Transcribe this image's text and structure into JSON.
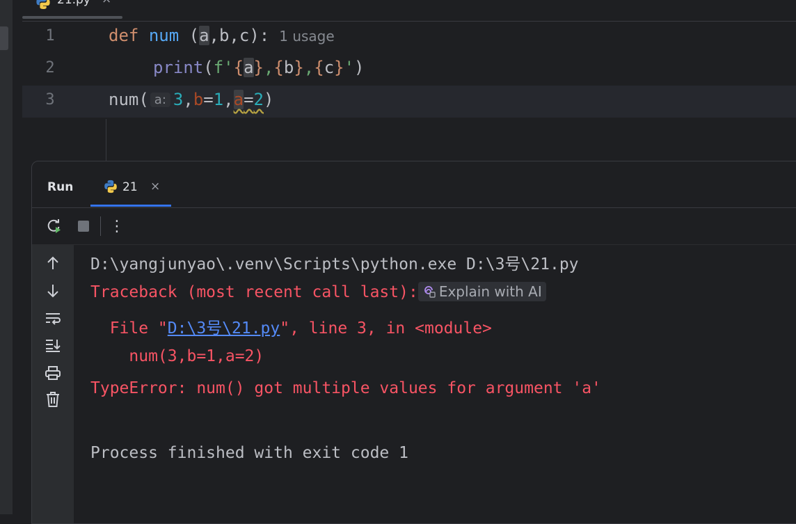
{
  "editor_tab": {
    "label": "21.py",
    "close": "×"
  },
  "editor": {
    "line_numbers": [
      "1",
      "2",
      "3"
    ],
    "line1": {
      "kw": "def",
      "fn": "num",
      "open": " (",
      "p_a": "a",
      "rest": ",b,c):",
      "hint": "1 usage"
    },
    "line2": {
      "builtin": "print",
      "open": "(",
      "fprefix": "f'",
      "b1": "{",
      "a": "a",
      "b2": "}",
      "c1": ",",
      "b3": "{",
      "b": "b",
      "b4": "}",
      "c2": ",",
      "b5": "{",
      "c": "c",
      "b6": "}",
      "q": "'",
      "close": ")"
    },
    "line3": {
      "call": "num(",
      "inlay": "a:",
      "n3": "3",
      "comma1": ",",
      "kb": "b",
      "eq1": "=",
      "n1": "1",
      "comma2": ",",
      "ka": "a",
      "eq2": "=",
      "n2": "2",
      "close": ")"
    }
  },
  "run_panel": {
    "title": "Run",
    "tab_label": "21",
    "tab_close": "×",
    "toolbar_more": "⋮"
  },
  "console": {
    "line1": "D:\\yangjunyao\\.venv\\Scripts\\python.exe D:\\3号\\21.py",
    "traceback": "Traceback (most recent call last):",
    "explain_ai": "Explain with AI",
    "file_prefix": "  File \"",
    "file_link": "D:\\3号\\21.py",
    "file_suffix": "\", line 3, in <module>",
    "code_line": "    num(3,b=1,a=2)",
    "error": "TypeError: num() got multiple values for argument 'a'",
    "exit": "Process finished with exit code 1"
  },
  "colors": {
    "background": "#1e1f22",
    "error": "#f75464",
    "link": "#548af7",
    "accent": "#3574f0"
  }
}
